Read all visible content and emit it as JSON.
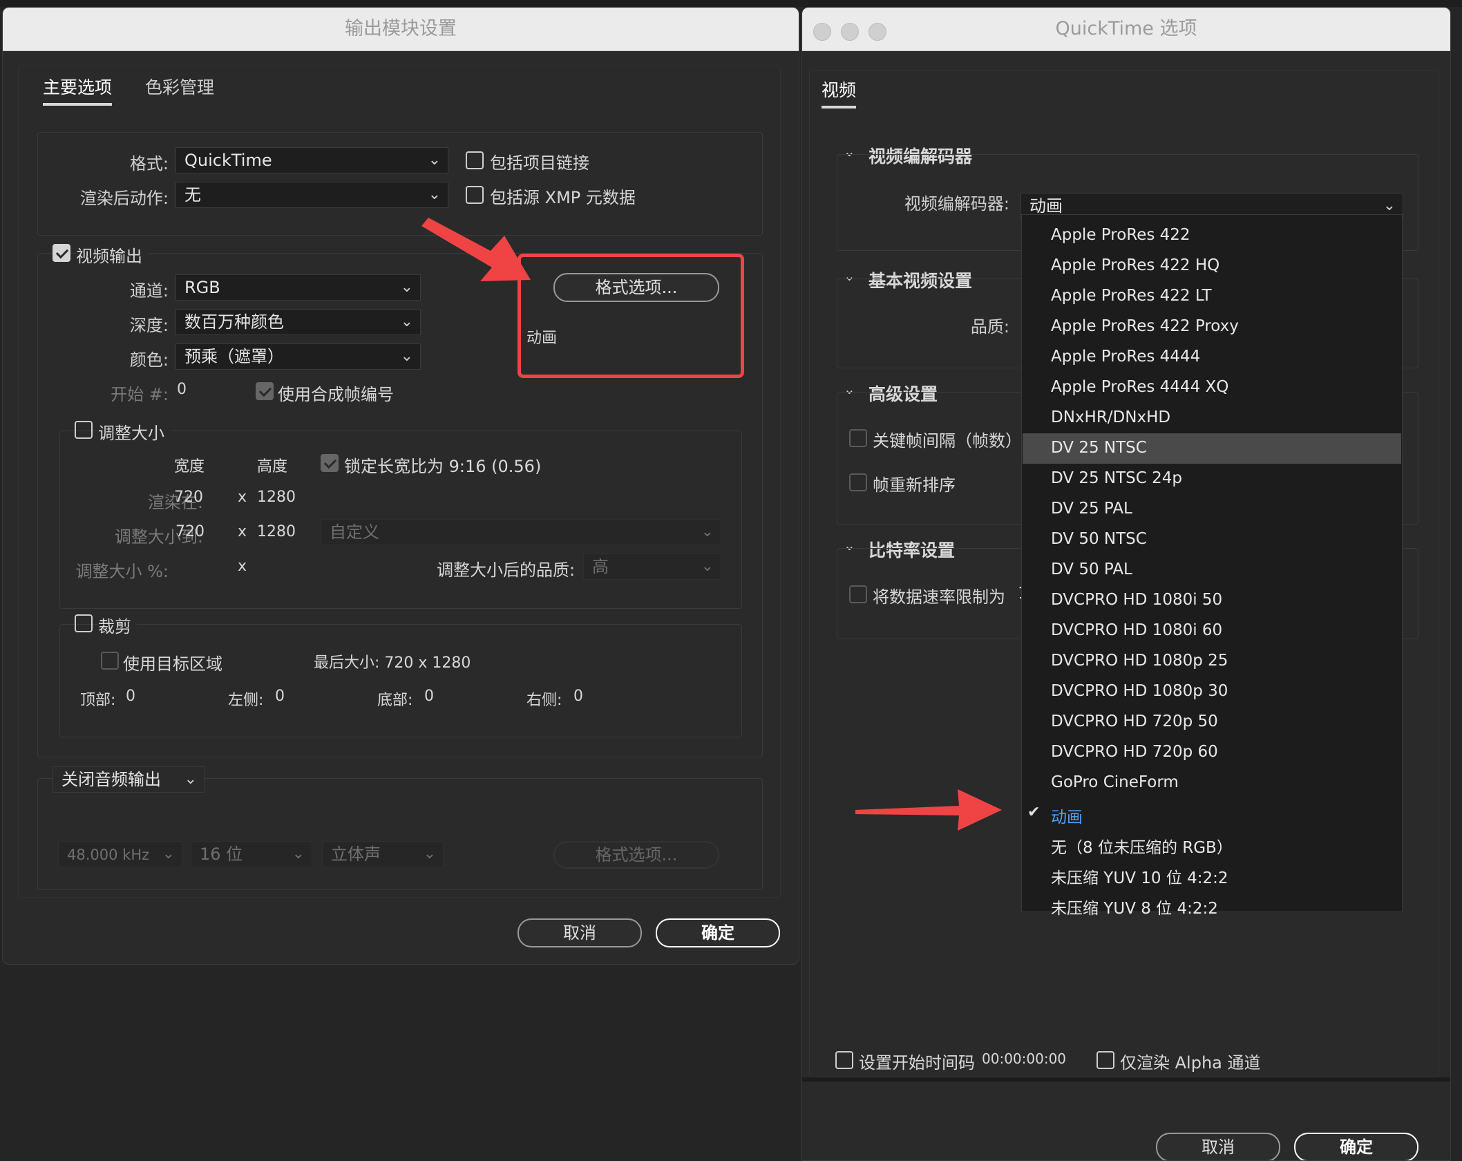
{
  "left_window": {
    "title": "输出模块设置",
    "tabs": [
      "主要选项",
      "色彩管理"
    ],
    "format_label": "格式:",
    "format_value": "QuickTime",
    "post_render_label": "渲染后动作:",
    "post_render_value": "无",
    "include_project_link": "包括项目链接",
    "include_xmp": "包括源 XMP 元数据",
    "video_output_label": "视频输出",
    "channel_label": "通道:",
    "channel_value": "RGB",
    "depth_label": "深度:",
    "depth_value": "数百万种颜色",
    "color_label": "颜色:",
    "color_value": "预乘（遮罩）",
    "start_label": "开始 #:",
    "start_value": "0",
    "use_comp_frame": "使用合成帧编号",
    "format_options_btn": "格式选项...",
    "format_summary": "动画",
    "resize_label": "调整大小",
    "width_hdr": "宽度",
    "height_hdr": "高度",
    "lock_ratio": "锁定长宽比为 9:16 (0.56)",
    "render_at_label": "渲染在:",
    "render_at_w": "720",
    "render_at_h": "1280",
    "resize_to_label": "调整大小到:",
    "resize_to_w": "720",
    "resize_to_h": "1280",
    "resize_preset": "自定义",
    "resize_pct_label": "调整大小 %:",
    "x_sep": "x",
    "resize_quality_label": "调整大小后的品质:",
    "resize_quality_value": "高",
    "crop_label": "裁剪",
    "use_roi": "使用目标区域",
    "final_size": "最后大小: 720 x 1280",
    "top_label": "顶部:",
    "top_value": "0",
    "left_label": "左侧:",
    "left_value": "0",
    "bottom_label": "底部:",
    "bottom_value": "0",
    "right_label": "右侧:",
    "right_value": "0",
    "audio_output": "关闭音频输出",
    "sample_rate": "48.000 kHz",
    "bit_depth": "16 位",
    "channels": "立体声",
    "audio_format_btn": "格式选项...",
    "cancel": "取消",
    "ok": "确定"
  },
  "right_window": {
    "title": "QuickTime 选项",
    "tab": "视频",
    "sec_codec": "视频编解码器",
    "codec_label": "视频编解码器:",
    "codec_value": "动画",
    "sec_basic": "基本视频设置",
    "quality_label": "品质:",
    "sec_advanced": "高级设置",
    "keyframe_label": "关键帧间隔（帧数）",
    "reorder_label": "帧重新排序",
    "sec_bitrate": "比特率设置",
    "limit_rate_label": "将数据速率限制为",
    "limit_rate_trunc": "1",
    "set_timecode": "设置开始时间码",
    "timecode_value": "00:00:00:00",
    "alpha_only": "仅渲染 Alpha 通道",
    "cancel": "取消",
    "ok": "确定",
    "codec_options": [
      "Apple ProRes 422",
      "Apple ProRes 422 HQ",
      "Apple ProRes 422 LT",
      "Apple ProRes 422 Proxy",
      "Apple ProRes 4444",
      "Apple ProRes 4444 XQ",
      "DNxHR/DNxHD",
      "DV 25 NTSC",
      "DV 25 NTSC 24p",
      "DV 25 PAL",
      "DV 50 NTSC",
      "DV 50 PAL",
      "DVCPRO HD 1080i 50",
      "DVCPRO HD 1080i 60",
      "DVCPRO HD 1080p 25",
      "DVCPRO HD 1080p 30",
      "DVCPRO HD 720p 50",
      "DVCPRO HD 720p 60",
      "GoPro CineForm",
      "动画",
      "无（8 位未压缩的 RGB）",
      "未压缩 YUV 10 位 4:2:2",
      "未压缩 YUV 8 位 4:2:2"
    ],
    "highlighted_index": 7,
    "selected_index": 19
  },
  "colors": {
    "annotation_red": "#f04444",
    "selected_blue": "#4ea3ff"
  }
}
